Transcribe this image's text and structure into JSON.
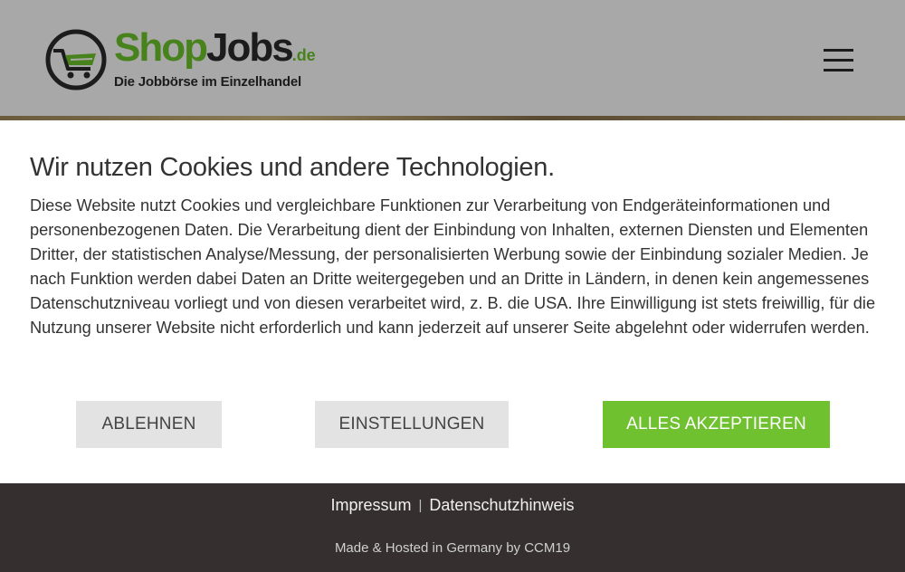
{
  "header": {
    "logo": {
      "shop": "Shop",
      "jobs": "Jobs",
      "domain": ".de",
      "tagline": "Die Jobbörse im Einzelhandel"
    },
    "menu_icon": "hamburger-menu-icon"
  },
  "cookie_banner": {
    "title": "Wir nutzen Cookies und andere Technologien.",
    "text": "Diese Website nutzt Cookies und vergleichbare Funktionen zur Verarbeitung von Endgeräteinformationen und personenbezogenen Daten. Die Verarbeitung dient der Einbindung von Inhalten, externen Diensten und Elementen Dritter, der statistischen Analyse/Messung, der personalisierten Werbung sowie der Einbindung sozialer Medien. Je nach Funktion werden dabei Daten an Dritte weitergegeben und an Dritte in Ländern, in denen kein angemessenes Datenschutzniveau vorliegt und von diesen verarbeitet wird, z. B. die USA. Ihre Einwilligung ist stets freiwillig, für die Nutzung unserer Website nicht erforderlich und kann jederzeit auf unserer Seite abgelehnt oder widerrufen werden.",
    "buttons": {
      "reject": "ABLEHNEN",
      "settings": "EINSTELLUNGEN",
      "accept": "ALLES AKZEPTIEREN"
    }
  },
  "footer": {
    "impressum": "Impressum",
    "separator": "|",
    "privacy": "Datenschutzhinweis",
    "credit": "Made & Hosted in Germany by CCM19"
  },
  "colors": {
    "brand_green": "#6ec62d",
    "accept_button": "#6fc12f",
    "footer_bg": "#35302f",
    "overlay_gray": "#a9a9a9"
  }
}
